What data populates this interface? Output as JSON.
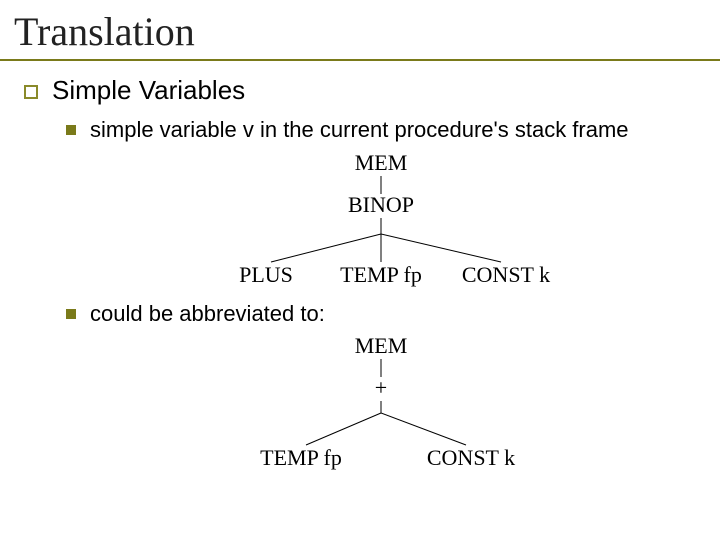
{
  "title": "Translation",
  "section": "Simple Variables",
  "bullet1": "simple variable v in the current procedure's stack frame",
  "bullet2": "could be abbreviated to:",
  "tree1": {
    "mem": "MEM",
    "binop": "BINOP",
    "plus": "PLUS",
    "temp": "TEMP fp",
    "const": "CONST k"
  },
  "tree2": {
    "mem": "MEM",
    "plus": "+",
    "temp": "TEMP fp",
    "const": "CONST k"
  }
}
